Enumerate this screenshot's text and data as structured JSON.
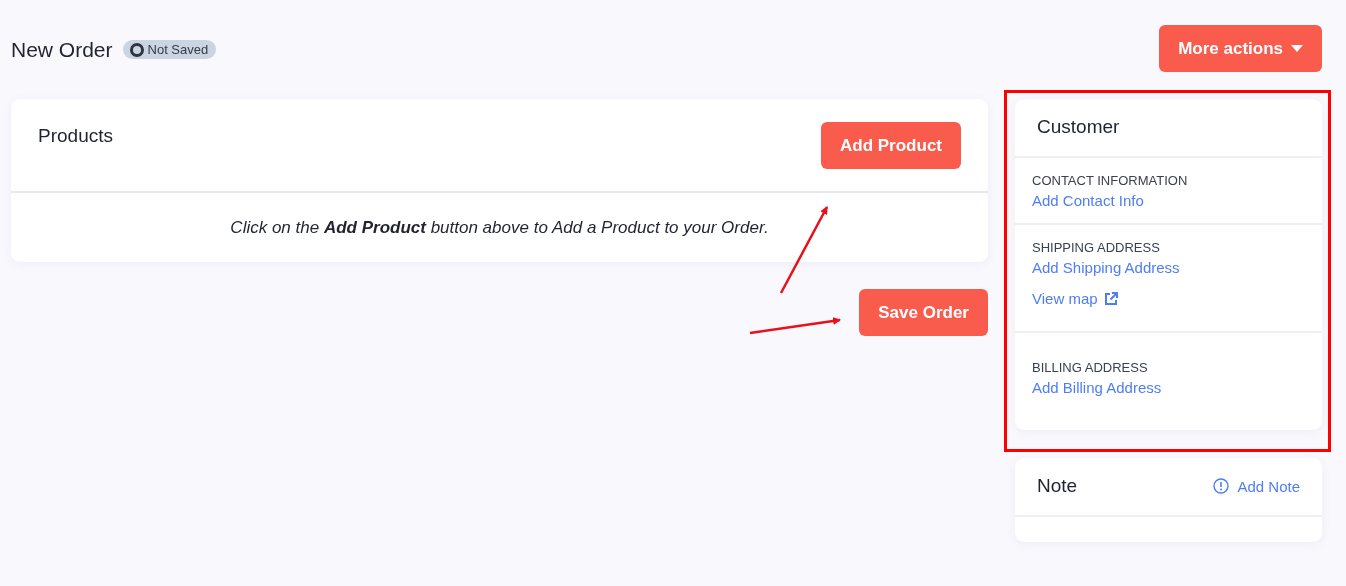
{
  "header": {
    "title": "New Order",
    "status_badge": "Not Saved",
    "more_actions_button": "More actions"
  },
  "products": {
    "title": "Products",
    "add_button": "Add Product",
    "empty_message": "Click on the **Add Product** button above to Add a Product to your Order."
  },
  "save_button": "Save Order",
  "customer": {
    "title": "Customer",
    "sections": [
      {
        "heading": "CONTACT INFORMATION",
        "link": "Add Contact Info"
      },
      {
        "heading": "SHIPPING ADDRESS",
        "link": "Add Shipping Address",
        "map_link": "View map"
      },
      {
        "heading": "BILLING ADDRESS",
        "link": "Add Billing Address"
      }
    ]
  },
  "note": {
    "title": "Note",
    "add_link": "Add Note"
  }
}
